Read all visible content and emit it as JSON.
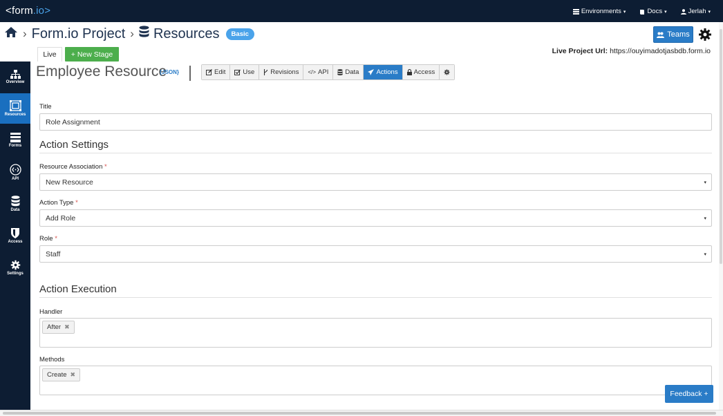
{
  "topbar": {
    "brand_left": "<form",
    "brand_right": ".io>",
    "environments": "Environments",
    "docs": "Docs",
    "user": "Jerlah"
  },
  "breadcrumb": {
    "project": "Form.io Project",
    "section": "Resources",
    "plan_badge": "Basic"
  },
  "header_actions": {
    "teams_label": "Teams"
  },
  "stage": {
    "live_tab": "Live",
    "new_stage": "+ New Stage",
    "url_label": "Live Project Url:",
    "url_value": "https://ouyimadotjasbdb.form.io"
  },
  "sidebar": {
    "items": [
      {
        "label": "Overview",
        "icon": "sitemap-icon"
      },
      {
        "label": "Resources",
        "icon": "resources-icon",
        "active": true
      },
      {
        "label": "Forms",
        "icon": "forms-icon"
      },
      {
        "label": "API",
        "icon": "api-icon"
      },
      {
        "label": "Data",
        "icon": "database-icon"
      },
      {
        "label": "Access",
        "icon": "shield-icon"
      },
      {
        "label": "Settings",
        "icon": "gear-icon"
      }
    ]
  },
  "resource": {
    "title": "Employee Resource",
    "json_tag": "{JSON}"
  },
  "tabs": [
    {
      "label": "Edit",
      "icon": "edit-icon"
    },
    {
      "label": "Use",
      "icon": "check-square-icon"
    },
    {
      "label": "Revisions",
      "icon": "branch-icon"
    },
    {
      "label": "API",
      "icon": "code-icon"
    },
    {
      "label": "Data",
      "icon": "database-icon"
    },
    {
      "label": "Actions",
      "icon": "paper-plane-icon",
      "active": true
    },
    {
      "label": "Access",
      "icon": "lock-icon"
    },
    {
      "label": "",
      "icon": "gear-icon"
    }
  ],
  "form": {
    "title_label": "Title",
    "title_value": "Role Assignment",
    "action_settings_heading": "Action Settings",
    "resource_assoc_label": "Resource Association",
    "resource_assoc_value": "New Resource",
    "action_type_label": "Action Type",
    "action_type_value": "Add Role",
    "role_label": "Role",
    "role_value": "Staff",
    "action_execution_heading": "Action Execution",
    "handler_label": "Handler",
    "handler_tag": "After",
    "methods_label": "Methods",
    "methods_tag": "Create",
    "required_mark": "*"
  },
  "feedback": "Feedback +",
  "colors": {
    "navy": "#0d1d33",
    "primary": "#2a7cc7",
    "success": "#4cae4c",
    "accent": "#4aa3ea",
    "required": "#d9534f"
  }
}
